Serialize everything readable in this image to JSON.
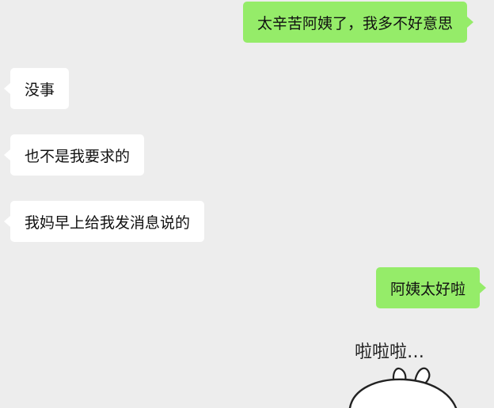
{
  "messages": [
    {
      "direction": "out",
      "text": "太辛苦阿姨了，我多不好意思"
    },
    {
      "direction": "in",
      "text": "没事"
    },
    {
      "direction": "in",
      "text": "也不是我要求的"
    },
    {
      "direction": "in",
      "text": "我妈早上给我发消息说的"
    },
    {
      "direction": "out",
      "text": "阿姨太好啦"
    }
  ],
  "sticker": {
    "caption": "啦啦啦…",
    "icon": "cartoon-bunny-sticker"
  },
  "colors": {
    "background": "#ededed",
    "outgoing_bubble": "#95ec69",
    "incoming_bubble": "#ffffff"
  }
}
